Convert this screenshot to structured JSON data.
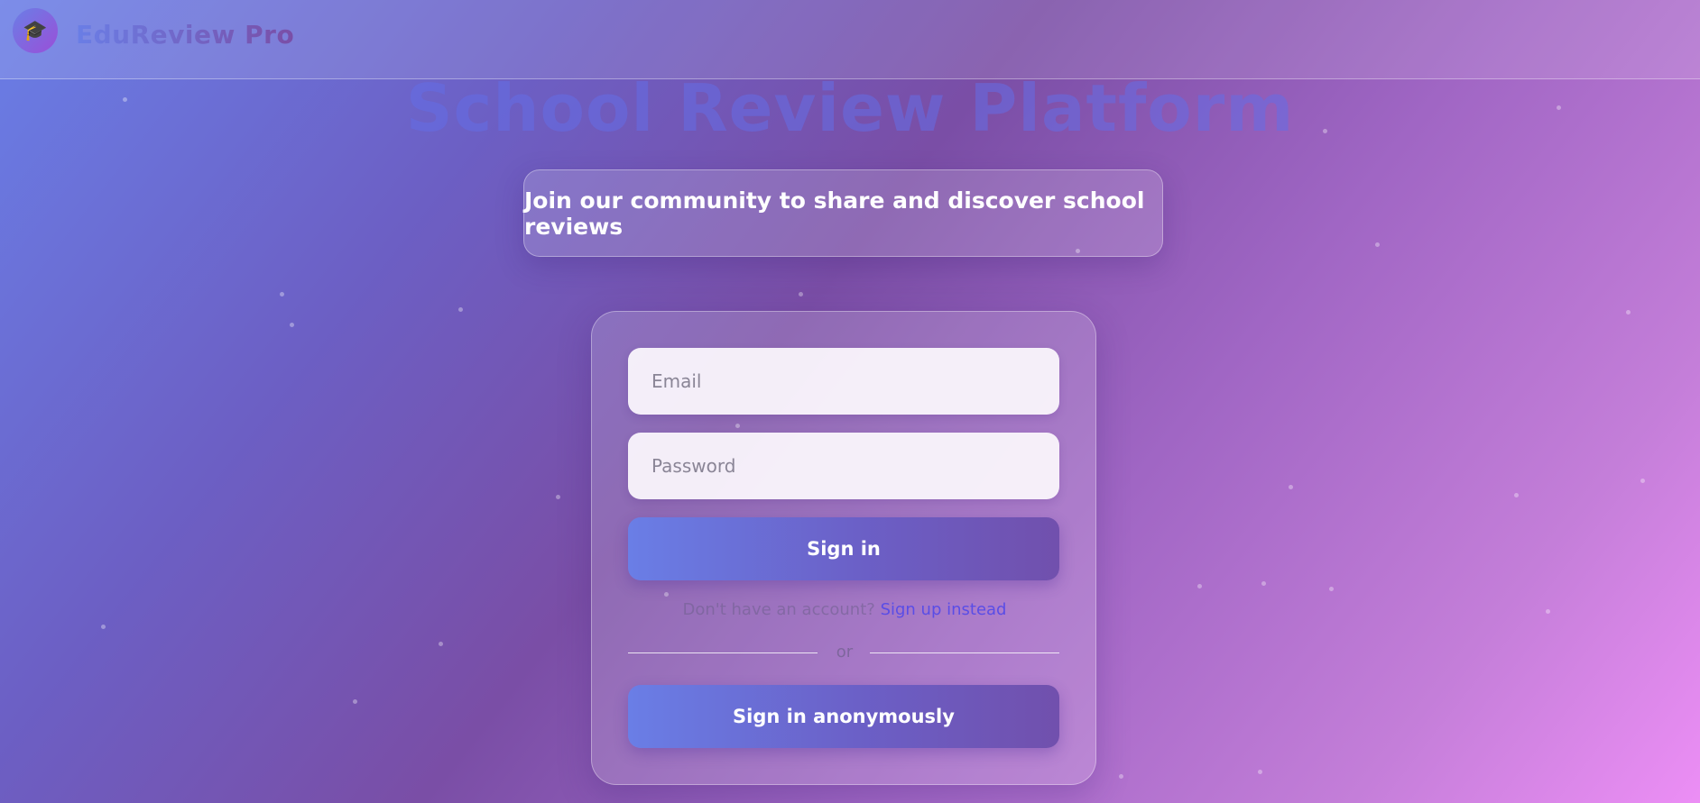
{
  "header": {
    "logo_icon": "graduation-cap-icon",
    "logo_glyph": "🎓",
    "brand_name": "EduReview Pro"
  },
  "hero": {
    "title": "School Review Platform",
    "subtitle": "Join our community to share and discover school reviews"
  },
  "login_form": {
    "email_placeholder": "Email",
    "email_value": "",
    "password_placeholder": "Password",
    "password_value": "",
    "sign_in_label": "Sign in",
    "signup_prompt": "Don't have an account?",
    "signup_link": "Sign up instead",
    "divider_text": "or",
    "anonymous_label": "Sign in anonymously"
  },
  "colors": {
    "accent_start": "#6a7ee6",
    "accent_end": "#7150ad",
    "link": "#5a4de6"
  }
}
